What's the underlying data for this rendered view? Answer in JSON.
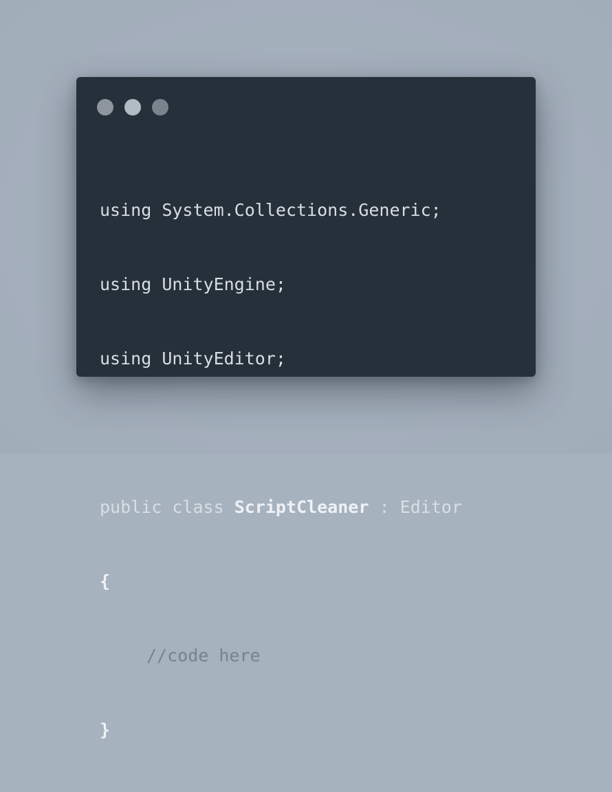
{
  "window": {
    "controls": [
      "close-dot",
      "minimize-dot",
      "maximize-dot"
    ]
  },
  "code": {
    "line1": {
      "keyword": "using",
      "namespace": "System.Collections.Generic",
      "end": ";"
    },
    "line2": {
      "keyword": "using",
      "namespace": "UnityEngine",
      "end": ";"
    },
    "line3": {
      "keyword": "using",
      "namespace": "UnityEditor",
      "end": ";"
    },
    "line5": {
      "modifier": "public",
      "keyword": "class",
      "class_name": "ScriptCleaner",
      "colon": ":",
      "base": "Editor"
    },
    "open_brace": "{",
    "comment": "//code here",
    "close_brace": "}"
  },
  "colors": {
    "background": "#a7b2bf",
    "editor_bg": "#25303a",
    "text": "#d9dee3",
    "comment": "#76828d"
  }
}
